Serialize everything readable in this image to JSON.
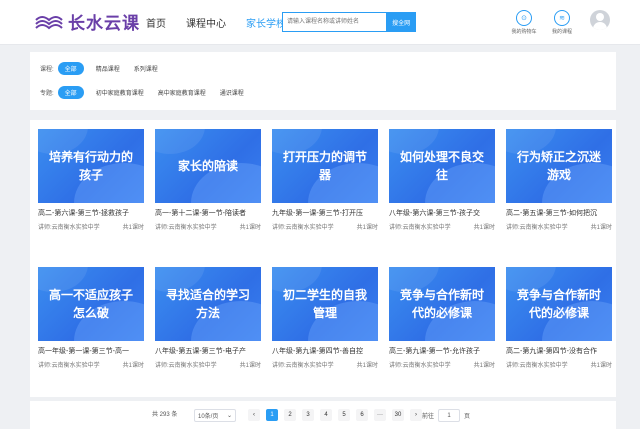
{
  "header": {
    "logo_text": "长水云课",
    "nav": [
      "首页",
      "课程中心",
      "家长学校"
    ],
    "search_placeholder": "请输入课程名称或讲师姓名",
    "search_button": "搜全网",
    "cart_label": "我的购物车",
    "courses_label": "我的课程"
  },
  "filters": {
    "course_label": "课程:",
    "course_options": [
      "全部",
      "精品课程",
      "系列课程"
    ],
    "topic_label": "专题:",
    "topic_options": [
      "全部",
      "初中家庭教育课程",
      "高中家庭教育课程",
      "通识课程"
    ]
  },
  "courses": [
    {
      "thumb": "培养有行动力的孩子",
      "name": "高二-第六课-第三节-拯救孩子",
      "teacher": "讲师:云南衡水实验中学",
      "hours": "共1课时"
    },
    {
      "thumb": "家长的陪读",
      "name": "高一-第十二课-第一节-陪读者",
      "teacher": "讲师:云南衡水实验中学",
      "hours": "共1课时"
    },
    {
      "thumb": "打开压力的调节器",
      "name": "九年级-第一课-第三节-打开压",
      "teacher": "讲师:云南衡水实验中学",
      "hours": "共1课时"
    },
    {
      "thumb": "如何处理不良交往",
      "name": "八年级-第六课-第三节-孩子交",
      "teacher": "讲师:云南衡水实验中学",
      "hours": "共1课时"
    },
    {
      "thumb": "行为矫正之沉迷游戏",
      "name": "高二-第五课-第三节-如何把沉",
      "teacher": "讲师:云南衡水实验中学",
      "hours": "共1课时"
    },
    {
      "thumb": "高一不适应孩子怎么破",
      "name": "高一年级-第一课-第三节-高一",
      "teacher": "讲师:云南衡水实验中学",
      "hours": "共1课时"
    },
    {
      "thumb": "寻找适合的学习方法",
      "name": "八年级-第五课-第三节-电子产",
      "teacher": "讲师:云南衡水实验中学",
      "hours": "共1课时"
    },
    {
      "thumb": "初二学生的自我管理",
      "name": "八年级-第九课-第四节-善自控",
      "teacher": "讲师:云南衡水实验中学",
      "hours": "共1课时"
    },
    {
      "thumb": "竞争与合作新时代的必修课",
      "name": "高三-第九课-第一节-允许孩子",
      "teacher": "讲师:云南衡水实验中学",
      "hours": "共1课时"
    },
    {
      "thumb": "竞争与合作新时代的必修课",
      "name": "高二-第九课-第四节-没有合作",
      "teacher": "讲师:云南衡水实验中学",
      "hours": "共1课时"
    }
  ],
  "pagination": {
    "total": "共 293 条",
    "page_size": "10条/页",
    "pages": [
      "1",
      "2",
      "3",
      "4",
      "5",
      "6",
      "···",
      "30"
    ],
    "current": "1",
    "goto_label": "前往",
    "goto_value": "1",
    "page_unit": "页"
  },
  "colors": {
    "accent": "#2a9df4",
    "logo": "#6a3fa8"
  }
}
